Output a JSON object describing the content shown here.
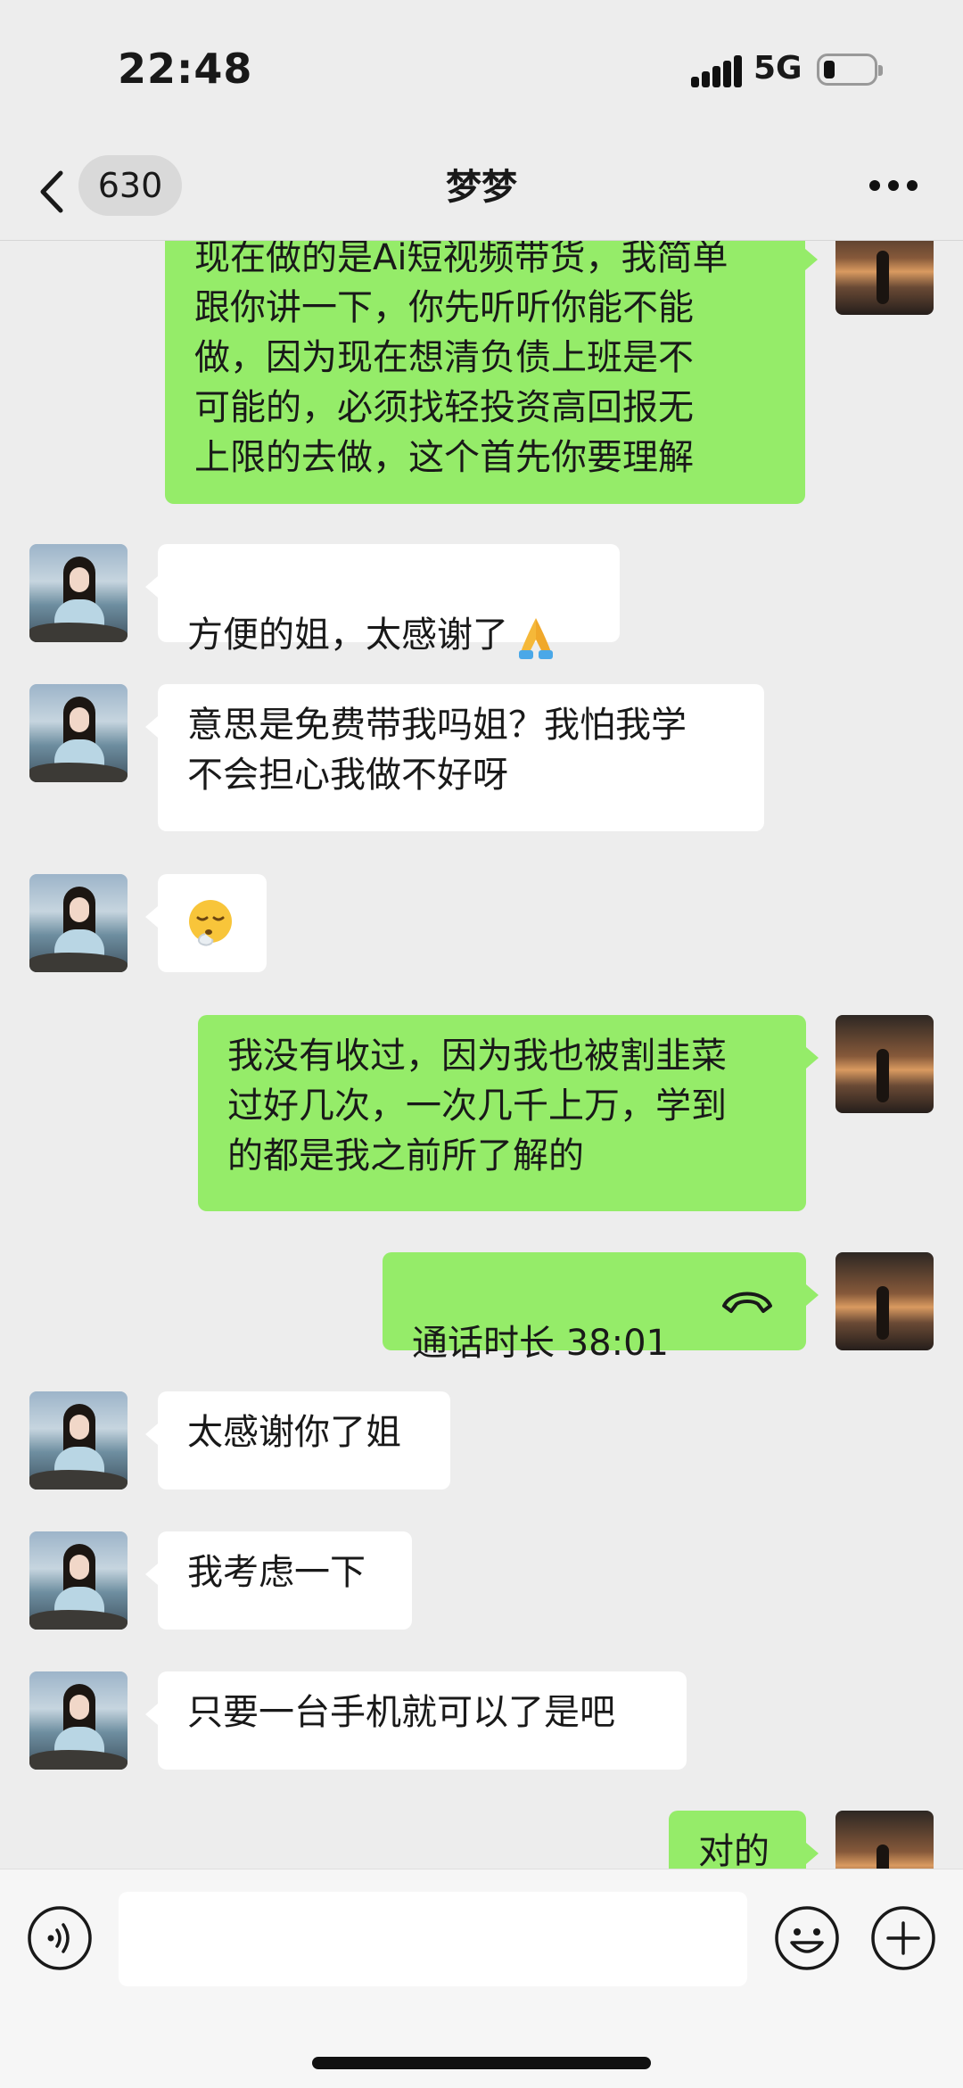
{
  "status_bar": {
    "time": "22:48",
    "network": "5G"
  },
  "nav": {
    "unread_count": "630",
    "title": "梦梦"
  },
  "messages": [
    {
      "side": "out",
      "text": "现在做的是Ai短视频带货，我简单\n跟你讲一下，你先听听你能不能\n做，因为现在想清负债上班是不\n可能的，必须找轻投资高回报无\n上限的去做，这个首先你要理解"
    },
    {
      "side": "in",
      "text": "方便的姐，太感谢了",
      "emoji": "folded-hands"
    },
    {
      "side": "in",
      "text": "意思是免费带我吗姐？我怕我学\n不会担心我做不好呀"
    },
    {
      "side": "in",
      "text": "",
      "emoji": "face-exhaling"
    },
    {
      "side": "out",
      "text": "我没有收过，因为我也被割韭菜\n过好几次，一次几千上万，学到\n的都是我之前所了解的"
    },
    {
      "side": "out",
      "type": "call",
      "text": "通话时长 38:01"
    },
    {
      "side": "in",
      "text": "太感谢你了姐"
    },
    {
      "side": "in",
      "text": "我考虑一下"
    },
    {
      "side": "in",
      "text": "只要一台手机就可以了是吧"
    },
    {
      "side": "out",
      "text": "对的"
    }
  ],
  "colors": {
    "out_bubble": "#95ec69",
    "in_bubble": "#ffffff",
    "background": "#ededed"
  },
  "input_bar": {
    "placeholder": ""
  }
}
